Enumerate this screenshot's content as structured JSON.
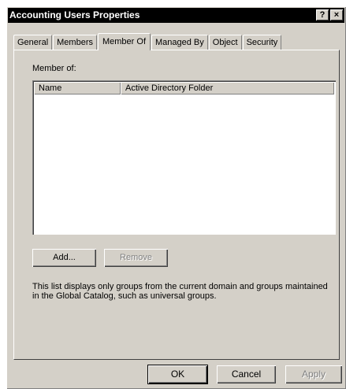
{
  "window": {
    "title": "Accounting Users Properties",
    "help_button": "?",
    "close_button": "×"
  },
  "tabs": [
    {
      "label": "General",
      "active": false
    },
    {
      "label": "Members",
      "active": false
    },
    {
      "label": "Member Of",
      "active": true
    },
    {
      "label": "Managed By",
      "active": false
    },
    {
      "label": "Object",
      "active": false
    },
    {
      "label": "Security",
      "active": false
    }
  ],
  "member_of": {
    "label": "Member of:",
    "columns": [
      "Name",
      "Active Directory Folder"
    ],
    "rows": []
  },
  "buttons": {
    "add": "Add...",
    "remove": "Remove",
    "ok": "OK",
    "cancel": "Cancel",
    "apply": "Apply"
  },
  "info_text": "This list displays only groups from the current domain and groups maintained in the Global Catalog, such as universal groups."
}
